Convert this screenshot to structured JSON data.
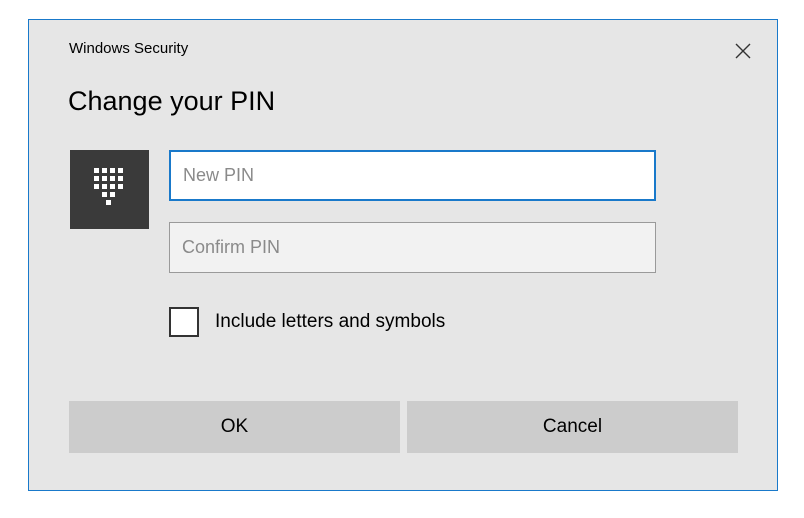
{
  "window": {
    "title": "Windows Security",
    "close_icon": "close-icon"
  },
  "heading": "Change your PIN",
  "keypad_icon": "keypad-icon",
  "fields": {
    "new_pin": {
      "placeholder": "New PIN",
      "value": ""
    },
    "confirm_pin": {
      "placeholder": "Confirm PIN",
      "value": ""
    }
  },
  "options": {
    "include_letters_label": "Include letters and symbols",
    "include_letters_checked": false
  },
  "buttons": {
    "ok": "OK",
    "cancel": "Cancel"
  },
  "colors": {
    "accent": "#1979ca",
    "dialog_background": "#e6e6e6",
    "button_background": "#cccccc",
    "tile_background": "#3a3a3a"
  }
}
